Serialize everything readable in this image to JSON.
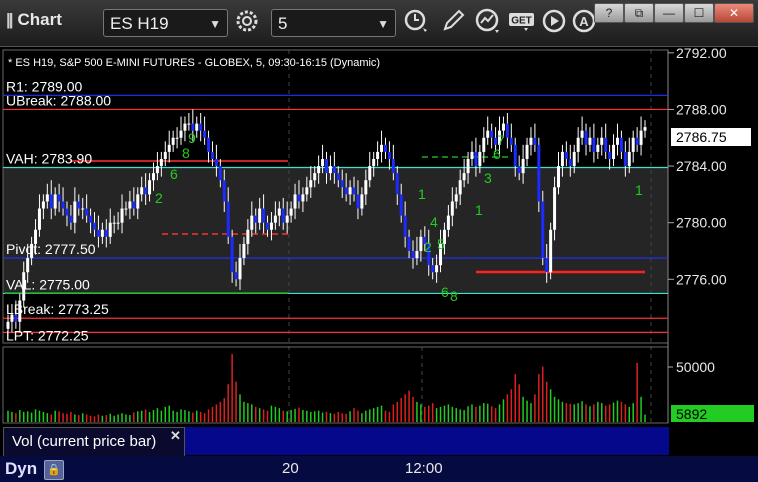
{
  "window": {
    "title": "Chart",
    "symbol": "ES H19",
    "interval": "5",
    "buttons": {
      "help": "?",
      "restore": "⧉",
      "minimize": "—",
      "maximize": "☐",
      "close": "✕"
    },
    "toolbar_icons": [
      "gear-icon",
      "clock-icon",
      "pencil-icon",
      "indicator-icon",
      "get-icon",
      "play-icon",
      "a-icon"
    ]
  },
  "chart": {
    "header": "* ES H19, S&P 500 E-MINI FUTURES - GLOBEX, 5, 09:30-16:15 (Dynamic)",
    "price_axis_labels": [
      "2792.00",
      "2788.00",
      "2784.00",
      "2780.00",
      "2776.00"
    ],
    "current_price": "2786.75",
    "levels": [
      {
        "text": "R1: 2789.00",
        "value": 2789.0,
        "color": "#2233ff"
      },
      {
        "text": "UBreak: 2788.00",
        "value": 2788.0,
        "color": "#ff3030"
      },
      {
        "text": "VAH: 2783.90",
        "value": 2783.9,
        "color": "#40e0d0"
      },
      {
        "text": "Pivot: 2777.50",
        "value": 2777.5,
        "color": "#2233ff"
      },
      {
        "text": "VAL: 2775.00",
        "value": 2775.0,
        "color": "#40e0d0"
      },
      {
        "text": "LBreak: 2773.25",
        "value": 2773.25,
        "color": "#ff3030"
      },
      {
        "text": "LPT: 2772.25",
        "value": 2772.25,
        "color": "#ff3030"
      }
    ],
    "ylim": [
      2771.5,
      2792.2
    ],
    "volume": {
      "axis_label": "50000",
      "current": "5892",
      "indicator_label": "Vol (current price bar)"
    },
    "x_ticks": [
      "20",
      "12:00"
    ],
    "status_label": "Dyn"
  },
  "chart_data": {
    "type": "candlestick",
    "title": "* ES H19, S&P 500 E-MINI FUTURES - GLOBEX, 5, 09:30-16:15 (Dynamic)",
    "ylim": [
      2771.5,
      2792.2
    ],
    "close": [
      2773.0,
      2773.5,
      2773.0,
      2774.5,
      2776.5,
      2777.5,
      2778.5,
      2779.5,
      2781.0,
      2781.5,
      2782.0,
      2781.0,
      2782.0,
      2781.5,
      2781.0,
      2780.5,
      2780.0,
      2781.5,
      2781.0,
      2781.0,
      2780.5,
      2780.0,
      2779.5,
      2779.0,
      2779.5,
      2779.0,
      2780.0,
      2780.0,
      2780.0,
      2781.0,
      2781.0,
      2781.5,
      2781.0,
      2782.0,
      2782.5,
      2782.0,
      2783.0,
      2783.5,
      2784.0,
      2784.5,
      2785.0,
      2785.5,
      2786.0,
      2786.0,
      2786.5,
      2787.0,
      2787.0,
      2786.5,
      2787.0,
      2786.5,
      2786.0,
      2785.0,
      2784.5,
      2784.0,
      2783.0,
      2781.5,
      2779.0,
      2776.5,
      2776.0,
      2777.5,
      2778.5,
      2779.5,
      2780.5,
      2780.0,
      2781.0,
      2780.0,
      2779.5,
      2780.0,
      2780.5,
      2781.0,
      2780.0,
      2780.5,
      2781.0,
      2782.0,
      2781.5,
      2782.0,
      2782.5,
      2783.0,
      2783.5,
      2784.0,
      2784.5,
      2783.5,
      2784.0,
      2783.5,
      2783.0,
      2782.5,
      2782.0,
      2782.5,
      2782.0,
      2781.0,
      2782.0,
      2783.0,
      2784.0,
      2784.5,
      2785.0,
      2785.5,
      2785.0,
      2784.5,
      2783.5,
      2782.0,
      2780.5,
      2779.0,
      2778.0,
      2777.5,
      2778.0,
      2779.0,
      2778.5,
      2777.0,
      2776.5,
      2777.0,
      2778.5,
      2779.5,
      2780.5,
      2781.5,
      2782.0,
      2783.0,
      2783.5,
      2784.5,
      2785.0,
      2784.0,
      2785.0,
      2786.0,
      2786.5,
      2786.0,
      2785.5,
      2786.5,
      2787.0,
      2786.0,
      2785.5,
      2784.0,
      2783.5,
      2784.5,
      2785.5,
      2786.0,
      2785.5,
      2781.5,
      2777.5,
      2776.5,
      2779.5,
      2782.5,
      2784.0,
      2785.0,
      2784.5,
      2784.0,
      2785.0,
      2786.0,
      2786.5,
      2785.5,
      2786.0,
      2785.0,
      2785.5,
      2786.0,
      2785.0,
      2784.5,
      2785.5,
      2786.0,
      2785.0,
      2784.0,
      2785.0,
      2786.0,
      2785.5,
      2786.5,
      2786.75
    ],
    "volume": [
      9000,
      8000,
      7000,
      9500,
      8000,
      8500,
      7500,
      10000,
      9000,
      8000,
      7000,
      6000,
      9000,
      8500,
      7000,
      6500,
      8000,
      6000,
      5500,
      7000,
      6000,
      5000,
      4500,
      6000,
      5000,
      5500,
      6500,
      5000,
      6000,
      7000,
      6000,
      5500,
      7500,
      8500,
      9000,
      10000,
      8000,
      9500,
      11000,
      9000,
      12000,
      13000,
      9000,
      8000,
      10000,
      9500,
      8500,
      7500,
      9000,
      8000,
      7000,
      10000,
      12000,
      14000,
      16000,
      19000,
      30000,
      54000,
      32000,
      22000,
      16000,
      15000,
      14000,
      12000,
      11000,
      10000,
      9000,
      13000,
      12000,
      11000,
      9000,
      8500,
      9500,
      10500,
      11500,
      9500,
      9000,
      8000,
      8500,
      9000,
      7500,
      8000,
      7000,
      6500,
      8000,
      7000,
      6500,
      8500,
      11000,
      9000,
      7000,
      9000,
      10000,
      11000,
      12000,
      13000,
      9000,
      8000,
      14000,
      16000,
      19000,
      22000,
      25000,
      20000,
      16000,
      14000,
      12000,
      13000,
      15000,
      11000,
      12000,
      13000,
      14000,
      12000,
      11000,
      10000,
      9500,
      12500,
      14000,
      12000,
      13000,
      15000,
      14500,
      12500,
      11000,
      14000,
      18000,
      22000,
      26000,
      38000,
      30000,
      20000,
      17000,
      15000,
      22000,
      38000,
      44000,
      32000,
      26000,
      20000,
      18000,
      16000,
      15000,
      14500,
      14000,
      15000,
      16500,
      14000,
      12500,
      14000,
      16000,
      15000,
      13000,
      14000,
      15500,
      17000,
      16000,
      14000,
      12000,
      15000,
      47000,
      20000,
      5892
    ],
    "volume_ylim": [
      0,
      58000
    ]
  }
}
